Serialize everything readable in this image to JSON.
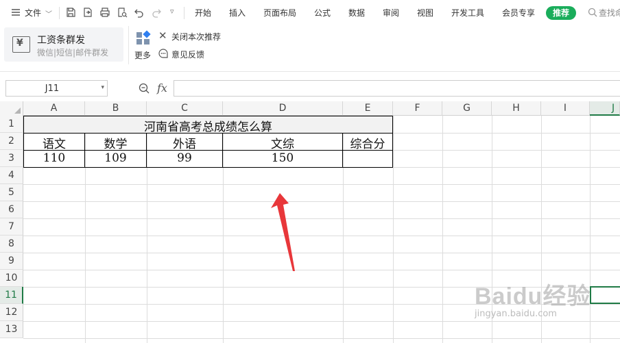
{
  "menubar": {
    "file_label": "文件",
    "tabs": [
      "开始",
      "插入",
      "页面布局",
      "公式",
      "数据",
      "审阅",
      "视图",
      "开发工具",
      "会员专享"
    ],
    "recommend_label": "推荐",
    "search_label": "查找命"
  },
  "ribbon": {
    "salary_title": "工资条群发",
    "salary_subtitle": "微信|短信|邮件群发",
    "more_label": "更多",
    "close_recommend_label": "关闭本次推荐",
    "feedback_label": "意见反馈"
  },
  "formula_bar": {
    "cell_ref": "J11",
    "fx_label": "fx",
    "formula_value": ""
  },
  "grid": {
    "columns": [
      "A",
      "B",
      "C",
      "D",
      "E",
      "F",
      "G",
      "H",
      "I",
      "J"
    ],
    "rows": [
      "1",
      "2",
      "3",
      "4",
      "5",
      "6",
      "7",
      "8",
      "9",
      "10",
      "11",
      "12",
      "13"
    ],
    "active_column": "J",
    "active_row": "11"
  },
  "table": {
    "title": "河南省高考总成绩怎么算",
    "headers": [
      "语文",
      "数学",
      "外语",
      "文综",
      "综合分"
    ],
    "values": [
      "110",
      "109",
      "99",
      "150",
      ""
    ]
  },
  "watermark": {
    "brand": "Baidu经验",
    "url": "jingyan.baidu.com"
  },
  "colors": {
    "accent_green": "#1e7a45",
    "recommend_green": "#1aad5b",
    "arrow_red": "#e8373a"
  }
}
